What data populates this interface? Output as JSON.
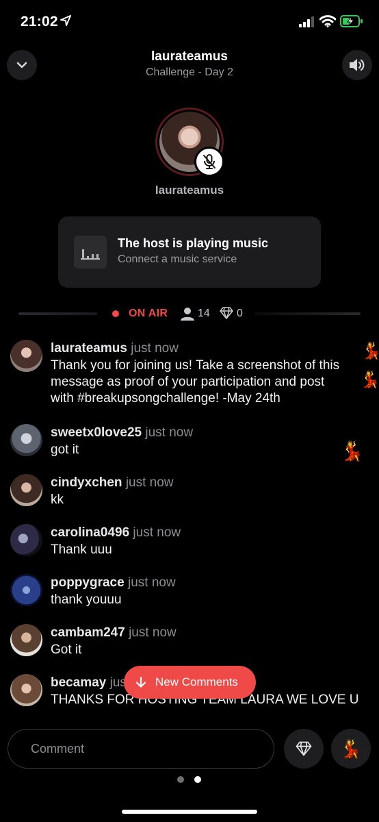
{
  "status_bar": {
    "time": "21:02",
    "icons": [
      "location-arrow-icon",
      "cellular-signal-icon",
      "wifi-icon",
      "battery-charging-icon"
    ],
    "battery_color": "#35c759"
  },
  "header": {
    "title": "laurateamus",
    "subtitle": "Challenge - Day 2",
    "left_icon": "chevron-down-icon",
    "right_icon": "speaker-volume-icon"
  },
  "host": {
    "name": "laurateamus",
    "badge_icon": "microphone-muted-icon"
  },
  "music_card": {
    "icon": "equalizer-bars-icon",
    "title": "The host is playing music",
    "subtitle": "Connect a music service"
  },
  "stats": {
    "on_air_label": "ON AIR",
    "viewers": "14",
    "gems": "0",
    "accent_color": "#ef4a47"
  },
  "comments": [
    {
      "user": "laurateamus",
      "time": "just now",
      "lines": [
        "Thank you for joining us! Take a screenshot of this",
        "message as proof of your participation and post",
        "with #breakupsongchallenge! -May 24th"
      ]
    },
    {
      "user": "sweetx0love25",
      "time": "just now",
      "lines": [
        "got it"
      ]
    },
    {
      "user": "cindyxchen",
      "time": "just now",
      "lines": [
        "kk"
      ]
    },
    {
      "user": "carolina0496",
      "time": "just now",
      "lines": [
        "Thank uuu"
      ]
    },
    {
      "user": "poppygrace",
      "time": "just now",
      "lines": [
        "thank youuu"
      ]
    },
    {
      "user": "cambam247",
      "time": "just now",
      "lines": [
        "Got it"
      ]
    },
    {
      "user": "becamay",
      "time": "just now",
      "lines": [
        "THANKS FOR HOSTING TEAM LAURA WE LOVE U"
      ]
    }
  ],
  "reactions": [
    "💃",
    "💃",
    "💃"
  ],
  "new_comments": {
    "label": "New Comments",
    "icon": "arrow-down-icon"
  },
  "composer": {
    "placeholder": "Comment",
    "gem_icon": "diamond-icon",
    "reaction_emoji": "💃"
  },
  "pagination": {
    "pages": 2,
    "current": 2
  }
}
